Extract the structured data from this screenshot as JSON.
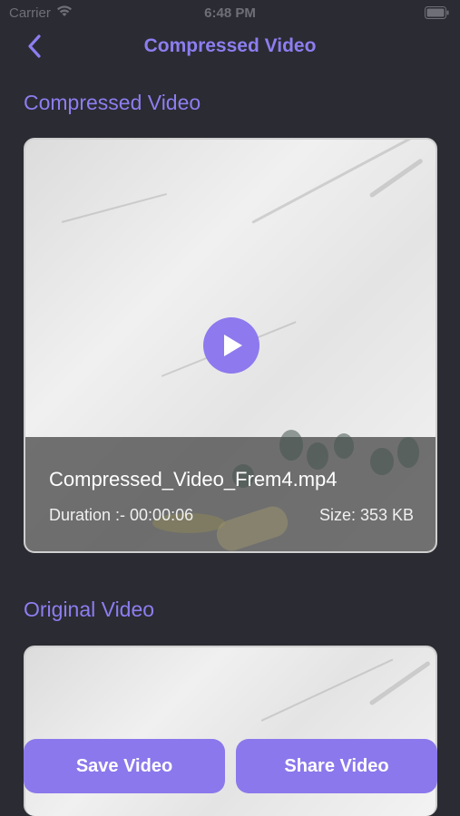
{
  "status_bar": {
    "carrier": "Carrier",
    "time": "6:48 PM"
  },
  "nav": {
    "title": "Compressed Video",
    "back_icon": "chevron-left-icon"
  },
  "compressed": {
    "section_title": "Compressed Video",
    "file_name": "Compressed_Video_Frem4.mp4",
    "duration": "Duration :- 00:00:06",
    "size": "Size: 353 KB"
  },
  "original": {
    "section_title": "Original Video"
  },
  "actions": {
    "save_label": "Save Video",
    "share_label": "Share Video"
  },
  "colors": {
    "accent": "#8c7ef0",
    "background": "#2b2b33",
    "button": "#8b78ec"
  }
}
